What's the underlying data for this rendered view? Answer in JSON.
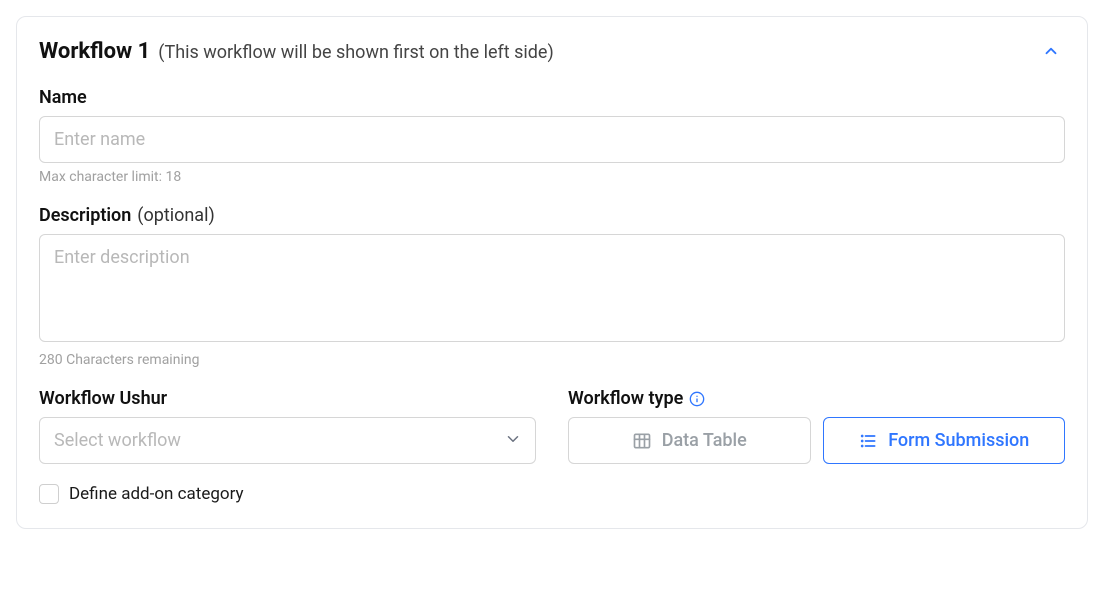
{
  "header": {
    "title": "Workflow 1",
    "subtitle": "(This workflow will be shown first on the left side)"
  },
  "name": {
    "label": "Name",
    "placeholder": "Enter name",
    "value": "",
    "helper": "Max character limit: 18"
  },
  "description": {
    "label": "Description",
    "optional": "(optional)",
    "placeholder": "Enter description",
    "value": "",
    "helper": "280 Characters remaining"
  },
  "ushur": {
    "label": "Workflow Ushur",
    "placeholder": "Select workflow",
    "value": ""
  },
  "type": {
    "label": "Workflow type",
    "options": [
      {
        "key": "data_table",
        "label": "Data Table",
        "active": false
      },
      {
        "key": "form_submission",
        "label": "Form Submission",
        "active": true
      }
    ]
  },
  "addon": {
    "label": "Define add-on category",
    "checked": false
  }
}
